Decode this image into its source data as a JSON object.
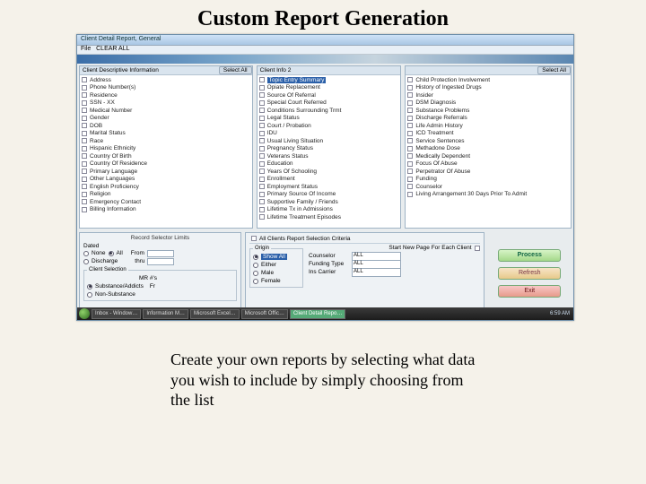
{
  "title": "Custom Report Generation",
  "caption": "Create your own reports by selecting what data you wish to include by simply choosing from the list",
  "app": {
    "window_title": "Client Detail Report, General",
    "menu": [
      "File",
      "CLEAR ALL"
    ]
  },
  "labels": {
    "select_all": "Select All"
  },
  "panels": {
    "left": {
      "title": "Client Descriptive Information",
      "items": [
        "Address",
        "Phone Number(s)",
        "Residence",
        "SSN - XX",
        "Medical Number",
        "Gender",
        "DOB",
        "Marital Status",
        "Race",
        "Hispanic Ethnicity",
        "Country Of Birth",
        "Country Of Residence",
        "Primary Language",
        "Other Languages",
        "English Proficiency",
        "Religion",
        "Emergency Contact",
        "Billing Information"
      ]
    },
    "mid": {
      "title": "Client Info 2",
      "highlight": 0,
      "items": [
        "Topic Entry Summary",
        "Opiate Replacement",
        "Source Of Referral",
        "Special Court Referred",
        "Conditions Surrounding Trmt",
        "Legal Status",
        "Court / Probation",
        "IDU",
        "Usual Living Situation",
        "Pregnancy Status",
        "Veterans Status",
        "Education",
        "Years Of Schooling",
        "Enrollment",
        "Employment Status",
        "Primary Source Of Income",
        "Supportive Family / Friends",
        "Lifetime Tx in Admissions",
        "Lifetime Treatment Episodes"
      ]
    },
    "right": {
      "title": "",
      "items": [
        "Child Protection Involvement",
        "History of Ingested Drugs",
        "Insider",
        "DSM Diagnosis",
        "Substance Problems",
        "Discharge Referrals",
        "Life Admin History",
        "ICD Treatment",
        "Service Sentences",
        "Methadone Dose",
        "Medically Dependent",
        "Focus Of Abuse",
        "Perpetrator Of Abuse",
        "Funding",
        "Counselor",
        "Living Arrangement 30 Days Prior To Admit"
      ]
    }
  },
  "lower": {
    "record_selector": {
      "title": "Record Selector Limits",
      "dated": "Dated",
      "opts": [
        "None",
        "All",
        "Discharge"
      ],
      "from": "From",
      "thru": "thru",
      "client_selection": "Client Selection",
      "mrn": "MR #'s",
      "fr": "Fr",
      "sel_opts": [
        "Substance/Addicts",
        "Non-Substance"
      ]
    },
    "criteria": {
      "title": "All Clients Report Selection Criteria",
      "origin": "Origin",
      "origin_opts": [
        {
          "label": "Show All",
          "sel": true
        },
        {
          "label": "Either",
          "sel": false
        },
        {
          "label": "Male",
          "sel": false
        },
        {
          "label": "Female",
          "sel": false
        }
      ],
      "start_page": "Start New Page For Each Client",
      "fields": [
        {
          "label": "Counselor",
          "value": "ALL"
        },
        {
          "label": "Funding Type",
          "value": "ALL"
        },
        {
          "label": "Ins Carrier",
          "value": "ALL"
        }
      ]
    }
  },
  "actions": {
    "process": "Process",
    "refresh": "Refresh",
    "exit": "Exit"
  },
  "taskbar": {
    "buttons": [
      "Inbox - Window…",
      "Information M…",
      "Microsoft Excel…",
      "Microsoft Offic…",
      "Client Detail Repo…"
    ],
    "active": 4,
    "clock": "6:59 AM"
  }
}
